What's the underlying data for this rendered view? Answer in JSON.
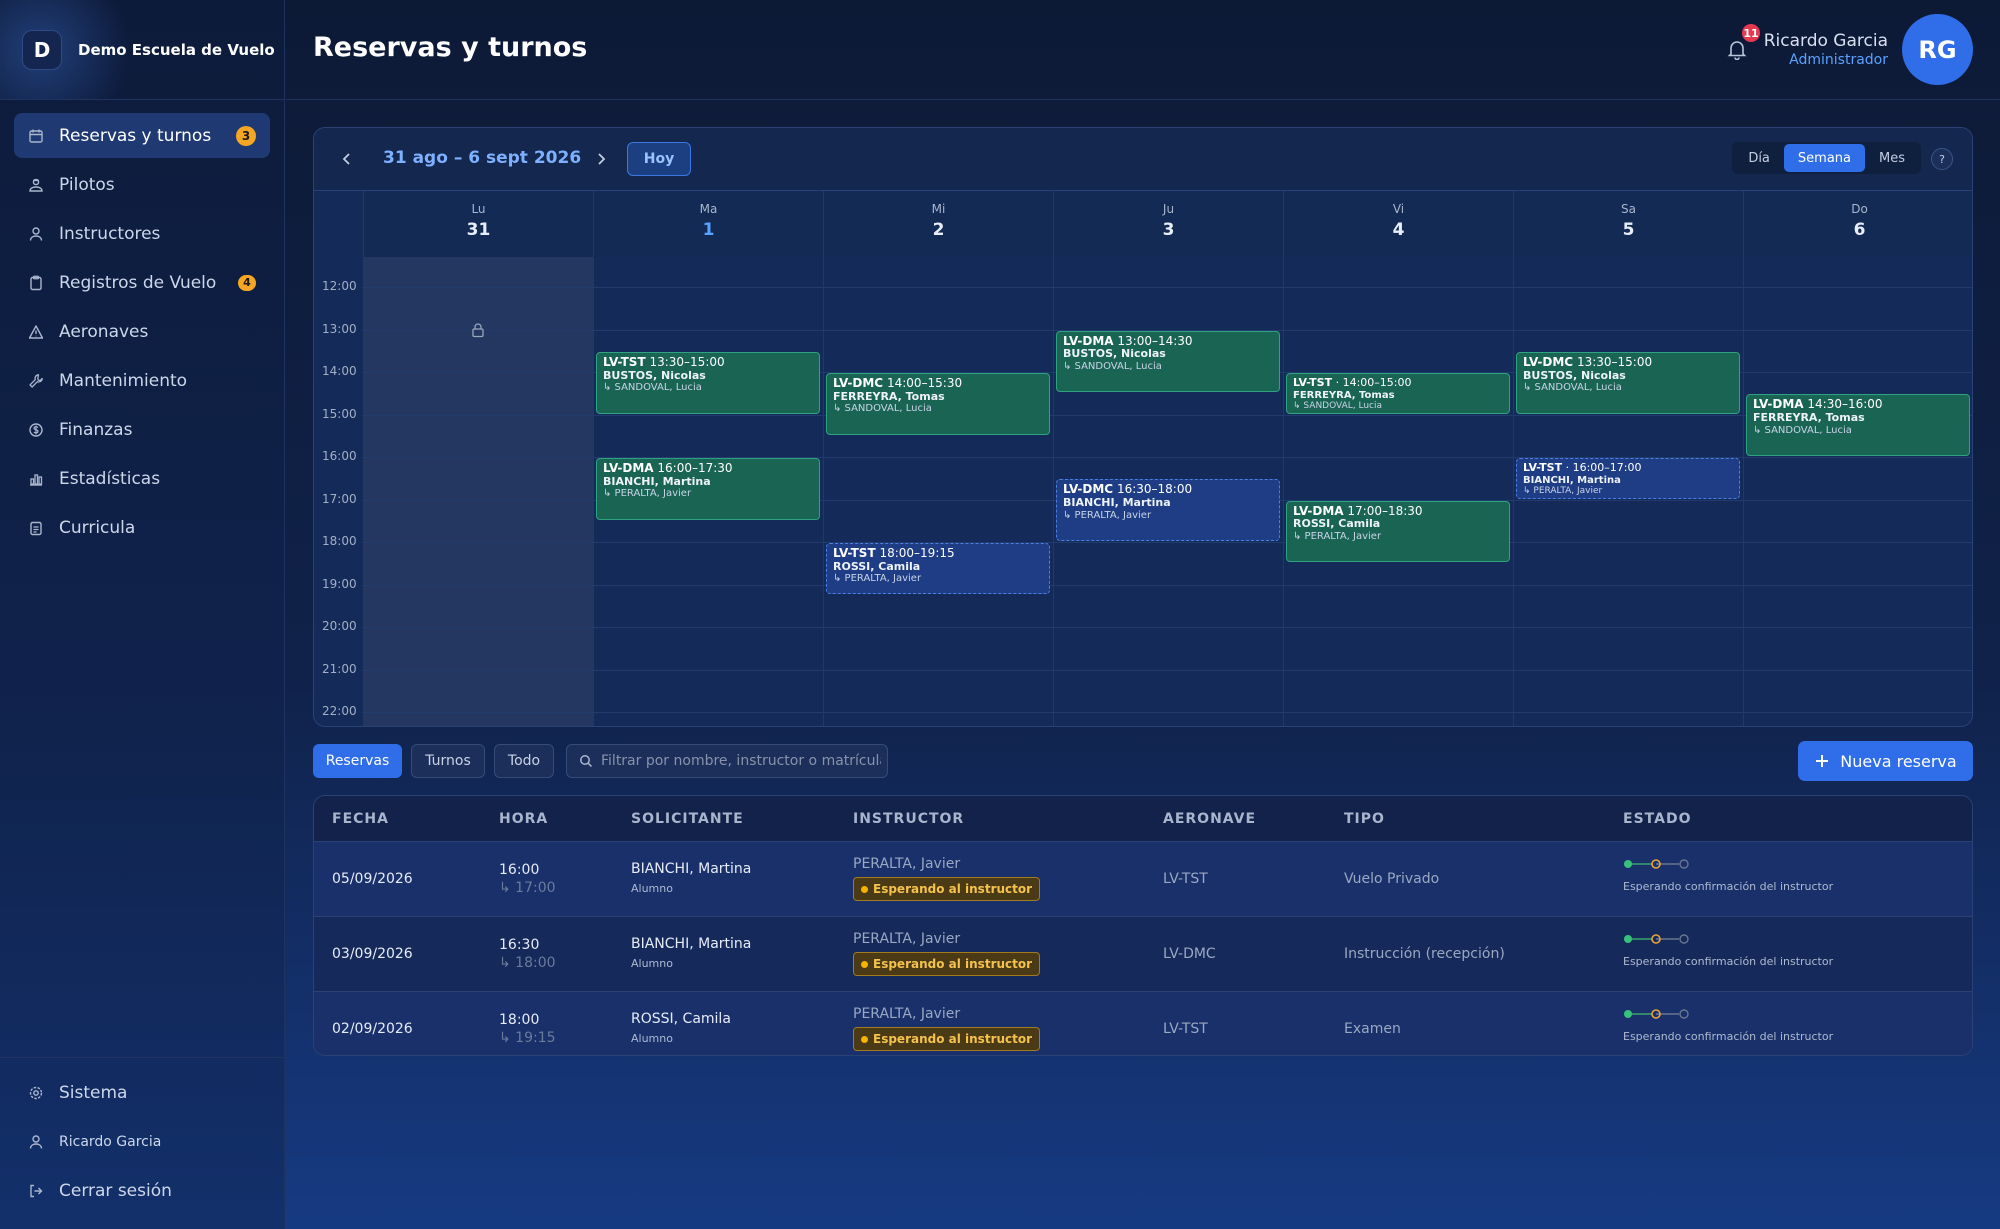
{
  "brand": {
    "logo_letter": "D",
    "name": "Demo Escuela de Vuelo"
  },
  "sidebar": {
    "items": [
      {
        "label": "Reservas y turnos",
        "badge": "3",
        "icon": "calendar-icon",
        "active": true
      },
      {
        "label": "Pilotos",
        "icon": "pilot-icon"
      },
      {
        "label": "Instructores",
        "icon": "person-icon"
      },
      {
        "label": "Registros de Vuelo",
        "badge": "4",
        "icon": "clipboard-icon"
      },
      {
        "label": "Aeronaves",
        "icon": "warning-triangle-icon"
      },
      {
        "label": "Mantenimiento",
        "icon": "wrench-icon"
      },
      {
        "label": "Finanzas",
        "icon": "dollar-icon"
      },
      {
        "label": "Estadísticas",
        "icon": "bar-chart-icon"
      },
      {
        "label": "Curricula",
        "icon": "clipboard-list-icon"
      }
    ],
    "bottom": {
      "system": "Sistema",
      "user": "Ricardo Garcia",
      "logout": "Cerrar sesión"
    }
  },
  "header": {
    "title": "Reservas y turnos",
    "notifications": "11",
    "user_name": "Ricardo Garcia",
    "user_role": "Administrador",
    "avatar_initials": "RG"
  },
  "calendar": {
    "range": "31 ago – 6 sept 2026",
    "today_label": "Hoy",
    "views": [
      "Día",
      "Semana",
      "Mes"
    ],
    "active_view": "Semana",
    "help": "?",
    "days": [
      {
        "abbr": "Lu",
        "num": "31"
      },
      {
        "abbr": "Ma",
        "num": "1",
        "today": true
      },
      {
        "abbr": "Mi",
        "num": "2"
      },
      {
        "abbr": "Ju",
        "num": "3"
      },
      {
        "abbr": "Vi",
        "num": "4"
      },
      {
        "abbr": "Sa",
        "num": "5"
      },
      {
        "abbr": "Do",
        "num": "6"
      }
    ],
    "hours": [
      "12:00",
      "13:00",
      "14:00",
      "15:00",
      "16:00",
      "17:00",
      "18:00",
      "19:00",
      "20:00",
      "21:00",
      "22:00"
    ],
    "events": [
      {
        "day": 1,
        "start": 13.5,
        "end": 15,
        "aircraft": "LV-TST",
        "time": "13:30–15:00",
        "pilot": "BUSTOS, Nicolas",
        "instructor": "↳ SANDOVAL, Lucia",
        "status": "confirmed"
      },
      {
        "day": 1,
        "start": 16,
        "end": 17.5,
        "aircraft": "LV-DMA",
        "time": "16:00–17:30",
        "pilot": "BIANCHI, Martina",
        "instructor": "↳ PERALTA, Javier",
        "status": "confirmed"
      },
      {
        "day": 2,
        "start": 14,
        "end": 15.5,
        "aircraft": "LV-DMC",
        "time": "14:00–15:30",
        "pilot": "FERREYRA, Tomas",
        "instructor": "↳ SANDOVAL, Lucia",
        "status": "confirmed"
      },
      {
        "day": 2,
        "start": 18,
        "end": 19.25,
        "aircraft": "LV-TST",
        "time": "18:00–19:15",
        "pilot": "ROSSI, Camila",
        "instructor": "↳ PERALTA, Javier",
        "status": "pending"
      },
      {
        "day": 3,
        "start": 13,
        "end": 14.5,
        "aircraft": "LV-DMA",
        "time": "13:00–14:30",
        "pilot": "BUSTOS, Nicolas",
        "instructor": "↳ SANDOVAL, Lucia",
        "status": "confirmed"
      },
      {
        "day": 3,
        "start": 16.5,
        "end": 18,
        "aircraft": "LV-DMC",
        "time": "16:30–18:00",
        "pilot": "BIANCHI, Martina",
        "instructor": "↳ PERALTA, Javier",
        "status": "pending"
      },
      {
        "day": 4,
        "start": 14,
        "end": 15,
        "aircraft": "LV-TST",
        "time": " · 14:00–15:00",
        "pilot": "FERREYRA, Tomas",
        "instructor": "↳ SANDOVAL, Lucia",
        "status": "confirmed",
        "compact": true
      },
      {
        "day": 4,
        "start": 17,
        "end": 18.5,
        "aircraft": "LV-DMA",
        "time": "17:00–18:30",
        "pilot": "ROSSI, Camila",
        "instructor": "↳ PERALTA, Javier",
        "status": "confirmed"
      },
      {
        "day": 5,
        "start": 13.5,
        "end": 15,
        "aircraft": "LV-DMC",
        "time": "13:30–15:00",
        "pilot": "BUSTOS, Nicolas",
        "instructor": "↳ SANDOVAL, Lucia",
        "status": "confirmed"
      },
      {
        "day": 5,
        "start": 16,
        "end": 17,
        "aircraft": "LV-TST",
        "time": " · 16:00–17:00",
        "pilot": "BIANCHI, Martina",
        "instructor": "↳ PERALTA, Javier",
        "status": "pending",
        "compact": true
      },
      {
        "day": 6,
        "start": 14.5,
        "end": 16,
        "aircraft": "LV-DMA",
        "time": "14:30–16:00",
        "pilot": "FERREYRA, Tomas",
        "instructor": "↳ SANDOVAL, Lucia",
        "status": "confirmed"
      }
    ]
  },
  "filters": {
    "tabs": [
      "Reservas",
      "Turnos",
      "Todo"
    ],
    "active": "Reservas",
    "search_placeholder": "Filtrar por nombre, instructor o matrícula"
  },
  "new_reservation": "Nueva reserva",
  "table": {
    "headers": [
      "FECHA",
      "HORA",
      "SOLICITANTE",
      "INSTRUCTOR",
      "AERONAVE",
      "TIPO",
      "ESTADO"
    ],
    "rows": [
      {
        "date": "05/09/2026",
        "start": "16:00",
        "end": "↳ 17:00",
        "requester": "BIANCHI, Martina",
        "role": "Alumno",
        "instructor": "PERALTA, Javier",
        "badge": "Esperando al instructor",
        "aircraft": "LV-TST",
        "type": "Vuelo Privado",
        "status": "Esperando confirmación del instructor"
      },
      {
        "date": "03/09/2026",
        "start": "16:30",
        "end": "↳ 18:00",
        "requester": "BIANCHI, Martina",
        "role": "Alumno",
        "instructor": "PERALTA, Javier",
        "badge": "Esperando al instructor",
        "aircraft": "LV-DMC",
        "type": "Instrucción (recepción)",
        "status": "Esperando confirmación del instructor"
      },
      {
        "date": "02/09/2026",
        "start": "18:00",
        "end": "↳ 19:15",
        "requester": "ROSSI, Camila",
        "role": "Alumno",
        "instructor": "PERALTA, Javier",
        "badge": "Esperando al instructor",
        "aircraft": "LV-TST",
        "type": "Examen",
        "status": "Esperando confirmación del instructor"
      }
    ]
  },
  "colors": {
    "accent": "#2f6ee8",
    "confirmed": "#1a6453",
    "pending": "#1e3d84",
    "badge": "#f5a623",
    "alert": "#e53950"
  }
}
